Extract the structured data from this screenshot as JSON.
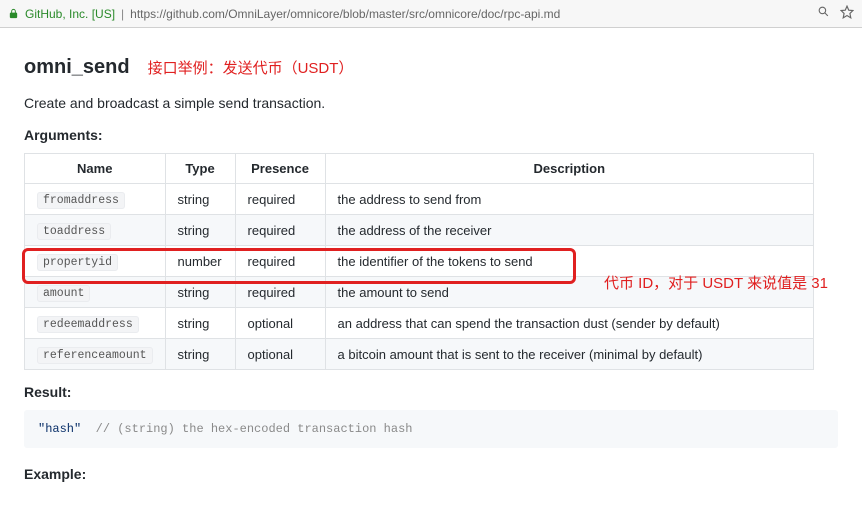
{
  "addressbar": {
    "site_label": "GitHub, Inc. [US]",
    "url": "https://github.com/OmniLayer/omnicore/blob/master/src/omnicore/doc/rpc-api.md"
  },
  "api": {
    "title": "omni_send",
    "title_annotation": "接口举例：发送代币（USDT）",
    "description": "Create and broadcast a simple send transaction.",
    "arguments_heading": "Arguments:",
    "columns": {
      "name": "Name",
      "type": "Type",
      "presence": "Presence",
      "description": "Description"
    },
    "rows": [
      {
        "name": "fromaddress",
        "type": "string",
        "presence": "required",
        "description": "the address to send from"
      },
      {
        "name": "toaddress",
        "type": "string",
        "presence": "required",
        "description": "the address of the receiver"
      },
      {
        "name": "propertyid",
        "type": "number",
        "presence": "required",
        "description": "the identifier of the tokens to send"
      },
      {
        "name": "amount",
        "type": "string",
        "presence": "required",
        "description": "the amount to send"
      },
      {
        "name": "redeemaddress",
        "type": "string",
        "presence": "optional",
        "description": "an address that can spend the transaction dust (sender by default)"
      },
      {
        "name": "referenceamount",
        "type": "string",
        "presence": "optional",
        "description": "a bitcoin amount that is sent to the receiver (minimal by default)"
      }
    ],
    "row_annotation": "代币 ID，对于 USDT 来说值是 31",
    "result_heading": "Result:",
    "result_code_str": "\"hash\"",
    "result_code_cmt": "  // (string) the hex-encoded transaction hash",
    "example_heading": "Example:"
  }
}
